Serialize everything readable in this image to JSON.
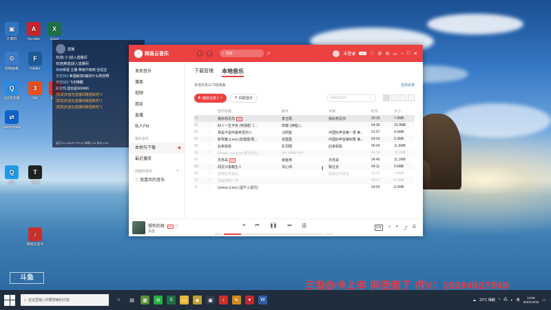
{
  "desktop": {
    "icons": [
      {
        "label": "计算机",
        "color": "#2f76c7",
        "glyph": "▣"
      },
      {
        "label": "Acrobat",
        "color": "#c8242b",
        "glyph": "A"
      },
      {
        "label": "Excel",
        "color": "#1d7044",
        "glyph": "X"
      },
      {
        "label": "控制面板",
        "color": "#3b7cc9",
        "glyph": "⚙"
      },
      {
        "label": "Fiddler",
        "color": "#1c5b9a",
        "glyph": "F"
      },
      {
        "label": "QQ浏览器",
        "color": "#2a8ce0",
        "glyph": "Q"
      },
      {
        "label": "360",
        "color": "#e94f1b",
        "glyph": "3"
      },
      {
        "label": "网易云",
        "color": "#d33a31",
        "glyph": "♪"
      },
      {
        "label": "TeamViewer",
        "color": "#0e63ce",
        "glyph": "⇄"
      },
      {
        "label": "QQ",
        "color": "#1f9be6",
        "glyph": "Q"
      },
      {
        "label": "Tools",
        "color": "#222222",
        "glyph": "T"
      },
      {
        "label": "网易云音乐",
        "color": "#c9302c",
        "glyph": "♪"
      }
    ]
  },
  "chat_overlay": {
    "title": "直播",
    "messages": [
      {
        "nick": "",
        "text": "欢迎[ 小 ]进入直播间",
        "orange": false
      },
      {
        "nick": "",
        "text": "欢迎[黄蓝]进入直播间",
        "orange": false
      },
      {
        "nick": "嗨嗨",
        "text": "恭喜 主播 等级升级到 全站宝",
        "orange": false
      },
      {
        "nick": "天空662:",
        "text": "希遇秘境5最好什么阵容啊",
        "orange": false
      },
      {
        "nick": "天空662:",
        "text": "飞天精霸",
        "orange": false
      },
      {
        "nick": "彩虹鸭:",
        "text": "送出星666666",
        "orange": false
      },
      {
        "nick": "",
        "text": "[贵宾]天蓝在直播间赠送鲜花*1",
        "orange": true
      },
      {
        "nick": "",
        "text": "[贵宾]天蓝在直播间赠送鲜花*1",
        "orange": true
      },
      {
        "nick": "",
        "text": "[贵宾]天蓝在直播间赠送鲜花*1",
        "orange": true
      }
    ],
    "stats": "延迟:23 1080P FPS:30 弹幕:1.2k 观众:0.9k"
  },
  "app": {
    "name": "网易云音乐",
    "search_placeholder": "搜索",
    "user_name": "未登录",
    "vip_label": "VIP",
    "sidebar": {
      "items": [
        "发现音乐",
        "播客",
        "视频",
        "朋友",
        "直播",
        "私人FM"
      ],
      "section_mine": "我的音乐",
      "mine_items": [
        "本地与下载",
        "最近播放"
      ],
      "section_playlists": "创建的歌单",
      "playlist_items": [
        "我喜欢的音乐"
      ]
    },
    "tabs": [
      "下载管理",
      "本地音乐"
    ],
    "count_text": "本地共有1179首歌曲",
    "select_dir": "选择目录",
    "play_all": "播放全部",
    "match_music": "匹配音乐",
    "search_local": "搜索本地音乐",
    "columns": [
      "音乐标题",
      "歌手",
      "专辑",
      "时长",
      "大小"
    ],
    "rows": [
      {
        "num": "01",
        "title": "我好想见你",
        "tag": "MV",
        "artist": "李玉刚",
        "album": "我好想见你",
        "time": "03:26",
        "size": "7.9MB",
        "grey": false,
        "selected": true
      },
      {
        "num": "02",
        "title": "好人一生平安 (电视剧《...",
        "tag": "",
        "artist": "李娜 (演唱)  (..",
        "album": "",
        "time": "04:30",
        "size": "10.3MB",
        "grey": false,
        "selected": false
      },
      {
        "num": "03",
        "title": "我是不是你最疼爱的人",
        "tag": "",
        "artist": "汪明荃",
        "album": "中国好声音第一季 第...",
        "time": "01:57",
        "size": "4.5MB",
        "grey": false,
        "selected": false
      },
      {
        "num": "04",
        "title": "新鸳鸯 (Live) (张霞霞/周...",
        "tag": "",
        "artist": "张霞霞",
        "album": "中国好声音第四季 第...",
        "time": "04:03",
        "size": "9.3MB",
        "grey": false,
        "selected": false
      },
      {
        "num": "05",
        "title": "后来偷偷",
        "tag": "",
        "artist": "彭羽翔",
        "album": "后来偷偷",
        "time": "05:04",
        "size": "11.6MB",
        "grey": false,
        "selected": false
      },
      {
        "num": "06",
        "title": "Stoudy (cut from 爱在记忆...",
        "tag": "",
        "artist": "sev stady.com",
        "album": "",
        "time": "04:30",
        "size": "10.3MB",
        "grey": true,
        "selected": false
      },
      {
        "num": "07",
        "title": "月亮哥",
        "tag": "MV",
        "artist": "谢金燕",
        "album": "月亮哥",
        "time": "04:45",
        "size": "11.1MB",
        "grey": false,
        "selected": false
      },
      {
        "num": "08",
        "title": "闻见只看路生人",
        "tag": "",
        "artist": "法心师",
        "album": "致过去",
        "time": "04:11",
        "size": "9.6MB",
        "grey": false,
        "selected": false
      },
      {
        "num": "09",
        "title": "愿陪在你身边",
        "tag": "",
        "artist": "",
        "album": "愿陪在你身边",
        "time": "03:15",
        "size": "7.4MB",
        "grey": true,
        "selected": false
      },
      {
        "num": "10",
        "title": "没有你的一天",
        "tag": "",
        "artist": "",
        "album": "",
        "time": "03:47",
        "size": "8.7MB",
        "grey": true,
        "selected": false
      },
      {
        "num": "11",
        "title": "Untrue (Live) (酒千小调兄)",
        "tag": "",
        "artist": "",
        "album": "",
        "time": "04:02",
        "size": "9.2MB",
        "grey": false,
        "selected": false
      }
    ],
    "player": {
      "track": "想你的夜",
      "tag": "MV",
      "artist": "关喆",
      "elapsed": "00:47",
      "duration": "04:39",
      "progress": 0.17,
      "quality": "标准"
    }
  },
  "overlay_text": {
    "banner": "三张办卡上车   抖径徒了  代V：15294527503",
    "watermark": "斗鱼"
  },
  "taskbar": {
    "search_placeholder": "在这里输入你要搜索的内容",
    "weather": "23°C 晴朗",
    "time": "13:06",
    "date": "2021/12/15",
    "ime": "英"
  }
}
